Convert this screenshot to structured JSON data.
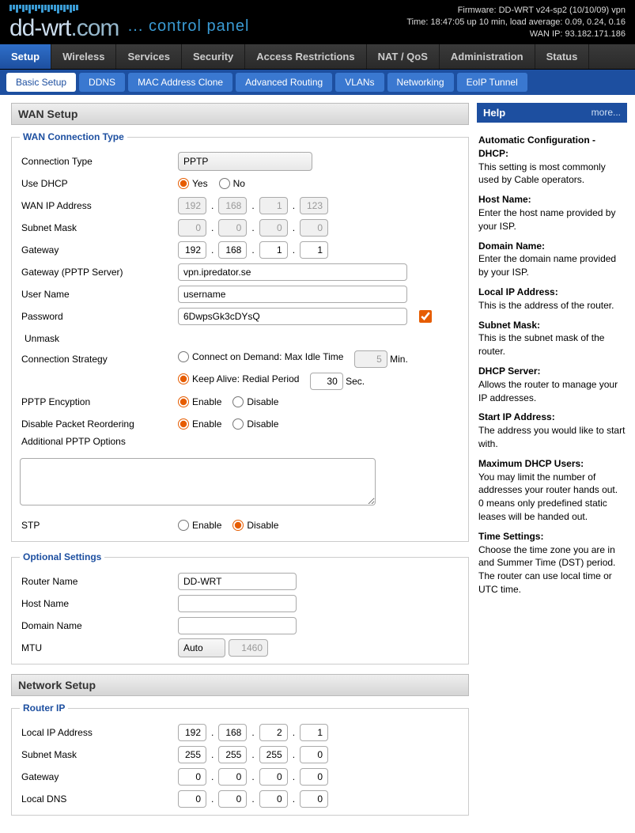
{
  "firmware": "Firmware: DD-WRT v24-sp2 (10/10/09) vpn",
  "time": "Time: 18:47:05 up 10 min, load average: 0.09, 0.24, 0.16",
  "wanip": "WAN IP: 93.182.171.186",
  "logo_cp": "... control panel",
  "tabs": {
    "setup": "Setup",
    "wireless": "Wireless",
    "services": "Services",
    "security": "Security",
    "access": "Access Restrictions",
    "nat": "NAT / QoS",
    "admin": "Administration",
    "status": "Status"
  },
  "subtabs": {
    "basic": "Basic Setup",
    "ddns": "DDNS",
    "mac": "MAC Address Clone",
    "routing": "Advanced Routing",
    "vlans": "VLANs",
    "networking": "Networking",
    "eoip": "EoIP Tunnel"
  },
  "section": {
    "wan": "WAN Setup",
    "net": "Network Setup"
  },
  "legend": {
    "conn": "WAN Connection Type",
    "opt": "Optional Settings",
    "routerip": "Router IP"
  },
  "labels": {
    "conn_type": "Connection Type",
    "use_dhcp": "Use DHCP",
    "wan_ip": "WAN IP Address",
    "subnet": "Subnet Mask",
    "gateway": "Gateway",
    "pptp_server": "Gateway (PPTP Server)",
    "username": "User Name",
    "password": "Password",
    "unmask": "Unmask",
    "conn_strategy": "Connection Strategy",
    "pptp_enc": "PPTP Encyption",
    "disable_reorder": "Disable Packet Reordering",
    "add_pptp": "Additional PPTP Options",
    "stp": "STP",
    "router_name": "Router Name",
    "host_name": "Host Name",
    "domain_name": "Domain Name",
    "mtu": "MTU",
    "local_ip": "Local IP Address",
    "subnet2": "Subnet Mask",
    "gateway2": "Gateway",
    "local_dns": "Local DNS"
  },
  "radio": {
    "yes": "Yes",
    "no": "No",
    "enable": "Enable",
    "disable": "Disable",
    "connect_demand": "Connect on Demand: Max Idle Time",
    "min": "Min.",
    "keep_alive": "Keep Alive: Redial Period",
    "sec": "Sec."
  },
  "values": {
    "conn_type": "PPTP",
    "wan_ip": [
      "192",
      "168",
      "1",
      "123"
    ],
    "subnet": [
      "0",
      "0",
      "0",
      "0"
    ],
    "gateway": [
      "192",
      "168",
      "1",
      "1"
    ],
    "pptp_server": "vpn.ipredator.se",
    "username": "username",
    "password": "6DwpsGk3cDYsQ",
    "idle_time": "5",
    "redial": "30",
    "router_name": "DD-WRT",
    "host_name": "",
    "domain_name": "",
    "mtu_mode": "Auto",
    "mtu_val": "1460",
    "local_ip": [
      "192",
      "168",
      "2",
      "1"
    ],
    "subnet2": [
      "255",
      "255",
      "255",
      "0"
    ],
    "gateway2": [
      "0",
      "0",
      "0",
      "0"
    ],
    "local_dns": [
      "0",
      "0",
      "0",
      "0"
    ]
  },
  "help": {
    "title": "Help",
    "more": "more...",
    "items": [
      {
        "t": "Automatic Configuration - DHCP:",
        "d": "This setting is most commonly used by Cable operators."
      },
      {
        "t": "Host Name:",
        "d": "Enter the host name provided by your ISP."
      },
      {
        "t": "Domain Name:",
        "d": "Enter the domain name provided by your ISP."
      },
      {
        "t": "Local IP Address:",
        "d": "This is the address of the router."
      },
      {
        "t": "Subnet Mask:",
        "d": "This is the subnet mask of the router."
      },
      {
        "t": "DHCP Server:",
        "d": "Allows the router to manage your IP addresses."
      },
      {
        "t": "Start IP Address:",
        "d": "The address you would like to start with."
      },
      {
        "t": "Maximum DHCP Users:",
        "d": "You may limit the number of addresses your router hands out. 0 means only predefined static leases will be handed out."
      },
      {
        "t": "Time Settings:",
        "d": "Choose the time zone you are in and Summer Time (DST) period. The router can use local time or UTC time."
      }
    ]
  }
}
